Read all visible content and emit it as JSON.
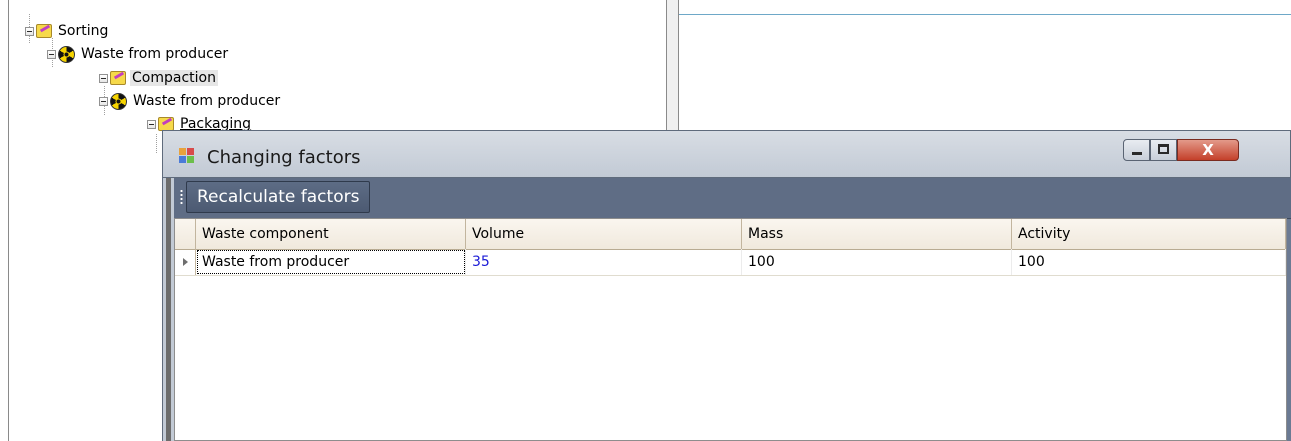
{
  "tree": {
    "nodes": [
      {
        "label": "Sorting",
        "icon": "folder-pencil-icon"
      },
      {
        "label": "Waste from producer",
        "icon": "radiation-icon"
      },
      {
        "label": "Compaction",
        "icon": "folder-pencil-icon"
      },
      {
        "label": "Waste from producer",
        "icon": "radiation-icon"
      },
      {
        "label": "Packaging",
        "icon": "folder-pencil-icon"
      }
    ]
  },
  "dialog": {
    "title": "Changing factors",
    "close_label": "X",
    "toolbar": {
      "recalculate_label": "Recalculate factors"
    },
    "grid": {
      "columns": [
        "Waste component",
        "Volume",
        "Mass",
        "Activity"
      ],
      "rows": [
        {
          "component": "Waste from producer",
          "volume": "35",
          "mass": "100",
          "activity": "100"
        }
      ]
    }
  },
  "colors": {
    "toolbar_bg": "#5f6d85",
    "volume_value": "#1a1ad6",
    "close_button": "#c4402a"
  }
}
